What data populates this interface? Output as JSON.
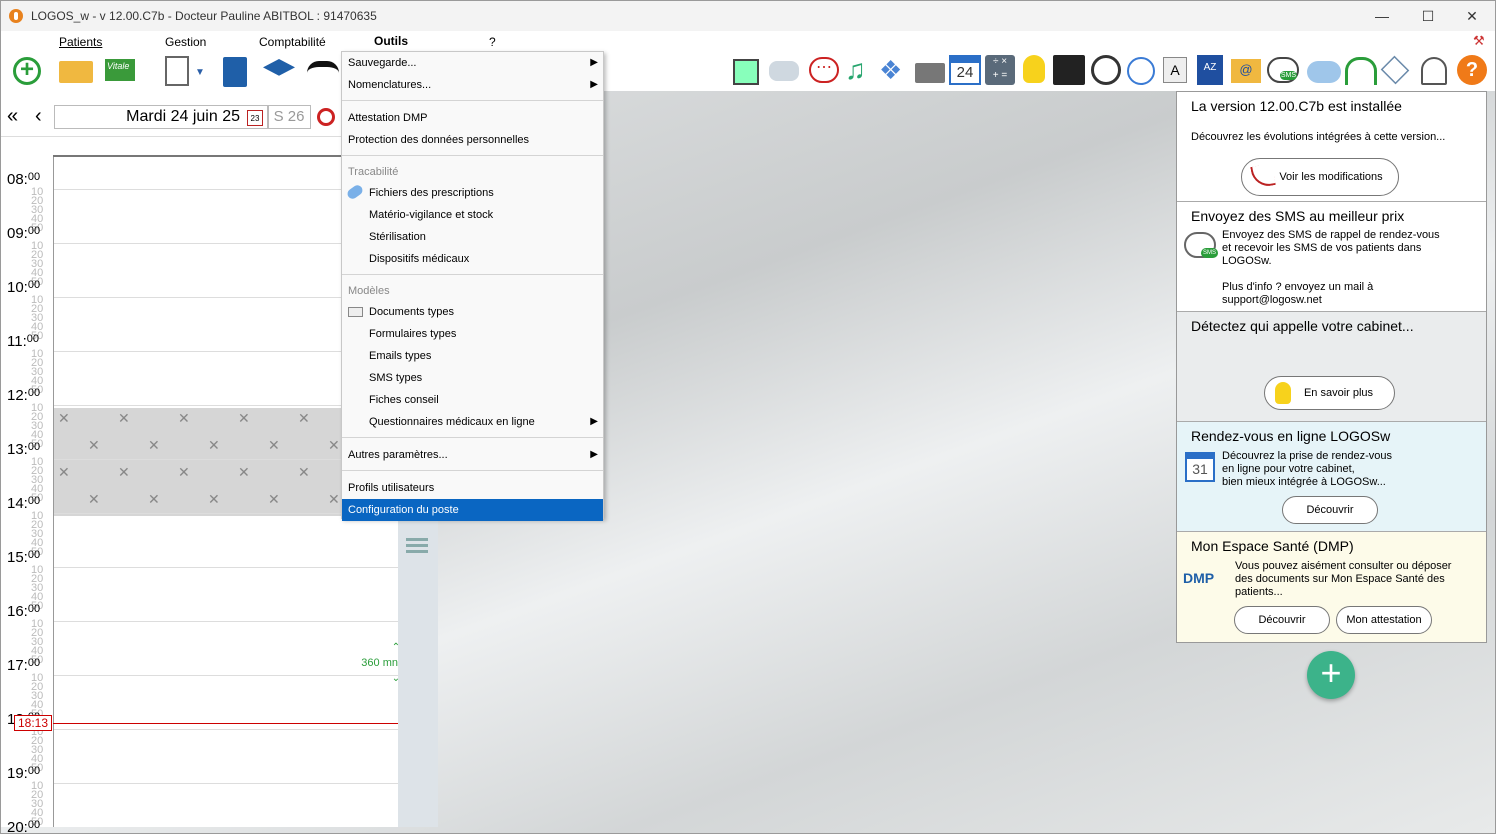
{
  "window": {
    "title": "LOGOS_w - v 12.00.C7b    -  Docteur Pauline ABITBOL : 91470635"
  },
  "menu": {
    "patients": "Patients",
    "gestion": "Gestion",
    "comptabilite": "Comptabilité",
    "outils": "Outils",
    "help": "?"
  },
  "agenda": {
    "date": "Mardi 24 juin 25",
    "week": "S 26",
    "now": "18:13",
    "duration": "360 mn",
    "hours": [
      "08:00",
      "09:00",
      "10:00",
      "11:00",
      "12:00",
      "13:00",
      "14:00",
      "15:00",
      "16:00",
      "17:00",
      "18:00",
      "19:00",
      "20:00"
    ],
    "minutes": [
      "10",
      "20",
      "30",
      "40",
      "50"
    ]
  },
  "dropdown": {
    "sauvegarde": "Sauvegarde...",
    "nomenclatures": "Nomenclatures...",
    "attestation": "Attestation DMP",
    "protection": "Protection des données personnelles",
    "tracabilite": "Tracabilité",
    "fichiers": "Fichiers des prescriptions",
    "materio": "Matério-vigilance et stock",
    "sterilisation": "Stérilisation",
    "dispositifs": "Dispositifs médicaux",
    "modeles": "Modèles",
    "documents": "Documents types",
    "formulaires": "Formulaires types",
    "emails": "Emails types",
    "sms": "SMS types",
    "fiches": "Fiches conseil",
    "questionnaires": "Questionnaires médicaux en ligne",
    "autres": "Autres paramètres...",
    "profils": "Profils utilisateurs",
    "config": "Configuration du poste"
  },
  "cards": {
    "version": {
      "title": "La version 12.00.C7b est installée",
      "text": "Découvrez les évolutions intégrées à cette version...",
      "button": "Voir les modifications"
    },
    "sms": {
      "title": "Envoyez des SMS au meilleur prix",
      "text1": "Envoyez des SMS de rappel de rendez-vous",
      "text2": "et recevoir les SMS de vos patients dans",
      "text3": "LOGOSw.",
      "text4": "Plus d'info ? envoyez un mail à",
      "text5": "support@logosw.net",
      "icon_text": "SMS"
    },
    "detect": {
      "title": "Détectez qui appelle votre cabinet...",
      "button": "En savoir plus"
    },
    "rdv": {
      "title": "Rendez-vous en ligne LOGOSw",
      "text1": "Découvrez la prise de rendez-vous",
      "text2": "en ligne pour votre cabinet,",
      "text3": "bien mieux intégrée à LOGOSw...",
      "button": "Découvrir",
      "day": "31"
    },
    "dmp": {
      "title": "Mon Espace Santé (DMP)",
      "text1": "Vous pouvez aisément consulter ou déposer",
      "text2": "des documents sur Mon Espace Santé des",
      "text3": "patients...",
      "button1": "Découvrir",
      "button2": "Mon attestation",
      "logo": "DMP"
    }
  },
  "toolbar": {
    "vitale": "Vitale",
    "calendar_day": "24",
    "letter": "A",
    "az": "AZ",
    "sms": "SMS",
    "at": "@"
  }
}
